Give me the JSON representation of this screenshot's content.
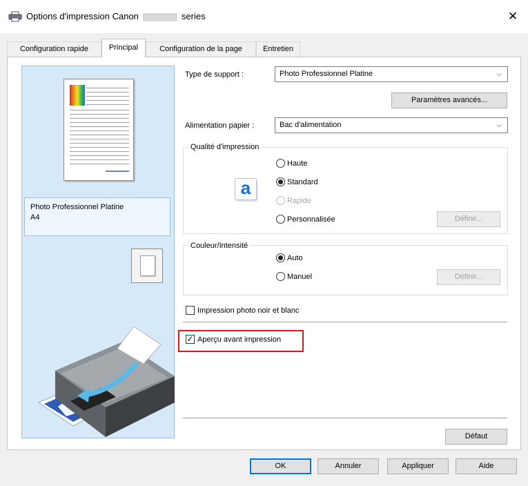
{
  "window": {
    "title_prefix": "Options d'impression Canon",
    "title_suffix": "series",
    "close_glyph": "✕"
  },
  "tabs": [
    {
      "label": "Configuration rapide",
      "active": false
    },
    {
      "label": "Principal",
      "active": true
    },
    {
      "label": "Configuration de la page",
      "active": false
    },
    {
      "label": "Entretien",
      "active": false
    }
  ],
  "preview": {
    "media_name": "Photo Professionnel Platine",
    "paper_size": "A4"
  },
  "settings": {
    "media_type": {
      "label": "Type de support :",
      "value": "Photo Professionnel Platine"
    },
    "advanced_button": "Paramètres avancés...",
    "paper_source": {
      "label": "Alimentation papier :",
      "value": "Bac d'alimentation"
    },
    "print_quality": {
      "title": "Qualité d'impression",
      "options": [
        {
          "label": "Haute",
          "checked": false,
          "disabled": false
        },
        {
          "label": "Standard",
          "checked": true,
          "disabled": false
        },
        {
          "label": "Rapide",
          "checked": false,
          "disabled": true
        },
        {
          "label": "Personnalisée",
          "checked": false,
          "disabled": false
        }
      ],
      "define_button": "Définir..."
    },
    "color_intensity": {
      "title": "Couleur/Intensité",
      "options": [
        {
          "label": "Auto",
          "checked": true
        },
        {
          "label": "Manuel",
          "checked": false
        }
      ],
      "define_button": "Définir..."
    },
    "grayscale": {
      "label": "Impression photo noir et blanc",
      "checked": false
    },
    "preview_before": {
      "label": "Aperçu avant impression",
      "checked": true
    },
    "default_button": "Défaut"
  },
  "footer": {
    "ok": "OK",
    "cancel": "Annuler",
    "apply": "Appliquer",
    "help": "Aide"
  },
  "colors": {
    "highlight": "#d9151c",
    "preview_panel": "#d6e9f8",
    "focus_blue": "#0078d7"
  },
  "icons": {
    "title": "printer-icon",
    "quality": "quality-letter-a-icon",
    "orientation": "portrait-page-icon"
  }
}
